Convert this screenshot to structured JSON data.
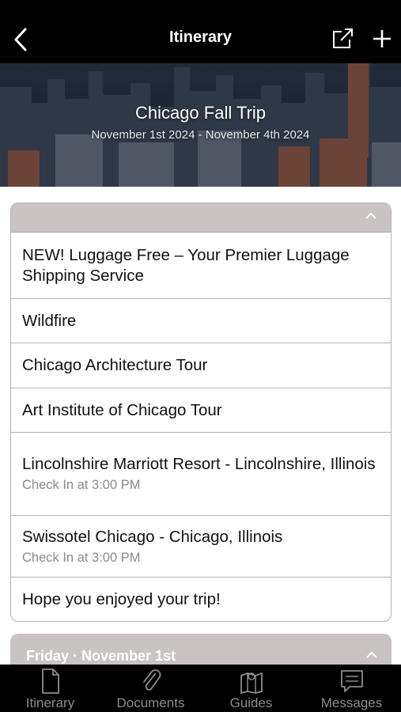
{
  "topbar": {
    "title": "Itinerary",
    "back_icon": "chevron-left-icon",
    "share_icon": "external-link-icon",
    "add_icon": "plus-icon"
  },
  "hero": {
    "trip_title": "Chicago Fall Trip",
    "dates": "November 1st 2024 - November 4th 2024"
  },
  "section1": {
    "items": [
      {
        "title": "NEW! Luggage Free – Your Premier Luggage Shipping Service",
        "subtitle": ""
      },
      {
        "title": "Wildfire",
        "subtitle": ""
      },
      {
        "title": "Chicago Architecture Tour",
        "subtitle": ""
      },
      {
        "title": "Art Institute of Chicago Tour",
        "subtitle": ""
      },
      {
        "title": "Lincolnshire Marriott Resort - Lincolnshire, Illinois",
        "subtitle": "Check In at 3:00 PM"
      },
      {
        "title": "Swissotel Chicago - Chicago, Illinois",
        "subtitle": "Check In at 3:00 PM"
      },
      {
        "title": "Hope you enjoyed your trip!",
        "subtitle": ""
      }
    ]
  },
  "section2": {
    "day_label": "Friday · November 1st"
  },
  "tabbar": {
    "tabs": [
      {
        "label": "Itinerary",
        "icon": "document-icon"
      },
      {
        "label": "Documents",
        "icon": "paperclip-icon"
      },
      {
        "label": "Guides",
        "icon": "map-icon"
      },
      {
        "label": "Messages",
        "icon": "message-icon"
      }
    ]
  },
  "colors": {
    "header_bg": "#000000",
    "section_header": "#c9c3c3",
    "tab_label": "#8c8c8c"
  }
}
